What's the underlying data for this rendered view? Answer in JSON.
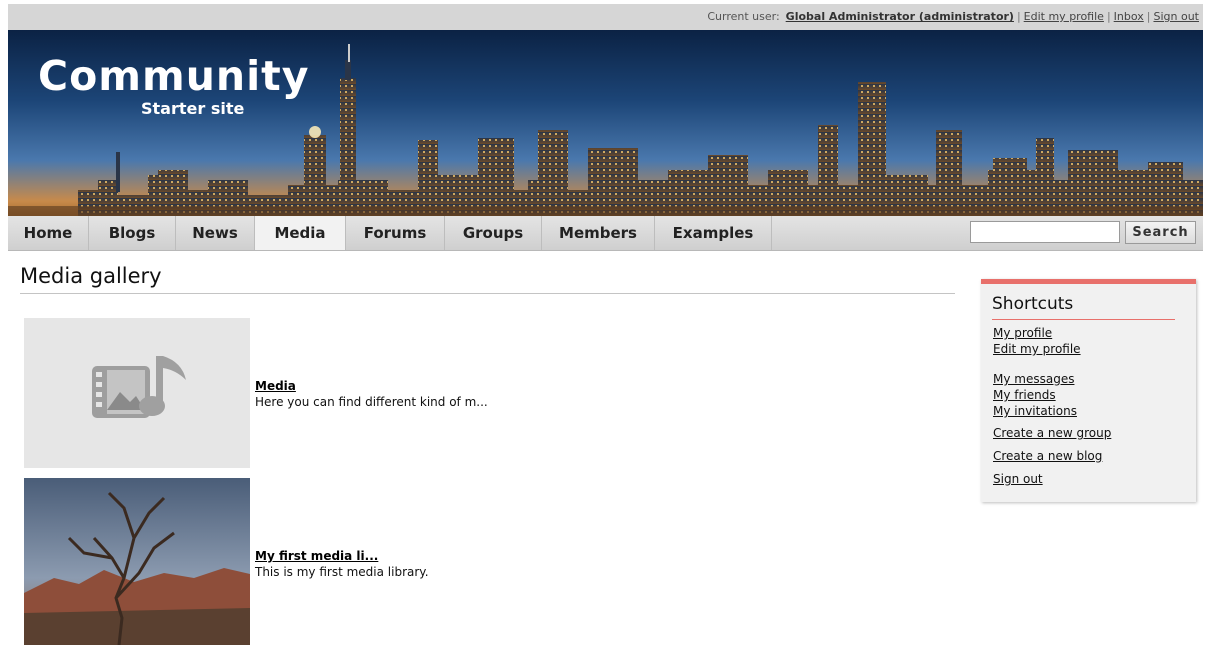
{
  "topbar": {
    "current_user_label": "Current user:",
    "user_name": "Global Administrator (administrator)",
    "links": [
      "Edit my profile",
      "Inbox",
      "Sign out"
    ]
  },
  "header": {
    "logo_title": "Community",
    "logo_subtitle": "Starter site"
  },
  "nav": {
    "items": [
      "Home",
      "Blogs",
      "News",
      "Media",
      "Forums",
      "Groups",
      "Members",
      "Examples"
    ],
    "active": "Media",
    "search_button": "Search",
    "search_value": ""
  },
  "main": {
    "title": "Media gallery",
    "items": [
      {
        "title": "Media",
        "description": "Here you can find different kind of m...",
        "icon": "media-library-icon"
      },
      {
        "title": "My first media li...",
        "description": "This is my first media library.",
        "icon": "tree-photo"
      }
    ]
  },
  "shortcuts": {
    "title": "Shortcuts",
    "links": [
      "My profile",
      "Edit my profile",
      "My messages",
      "My friends",
      "My invitations",
      "Create a new group",
      "Create a new blog",
      "Sign out"
    ]
  },
  "colors": {
    "accent": "#e8706b",
    "nav_bg": "#d4d4d4",
    "topbar_bg": "#d6d6d6"
  }
}
